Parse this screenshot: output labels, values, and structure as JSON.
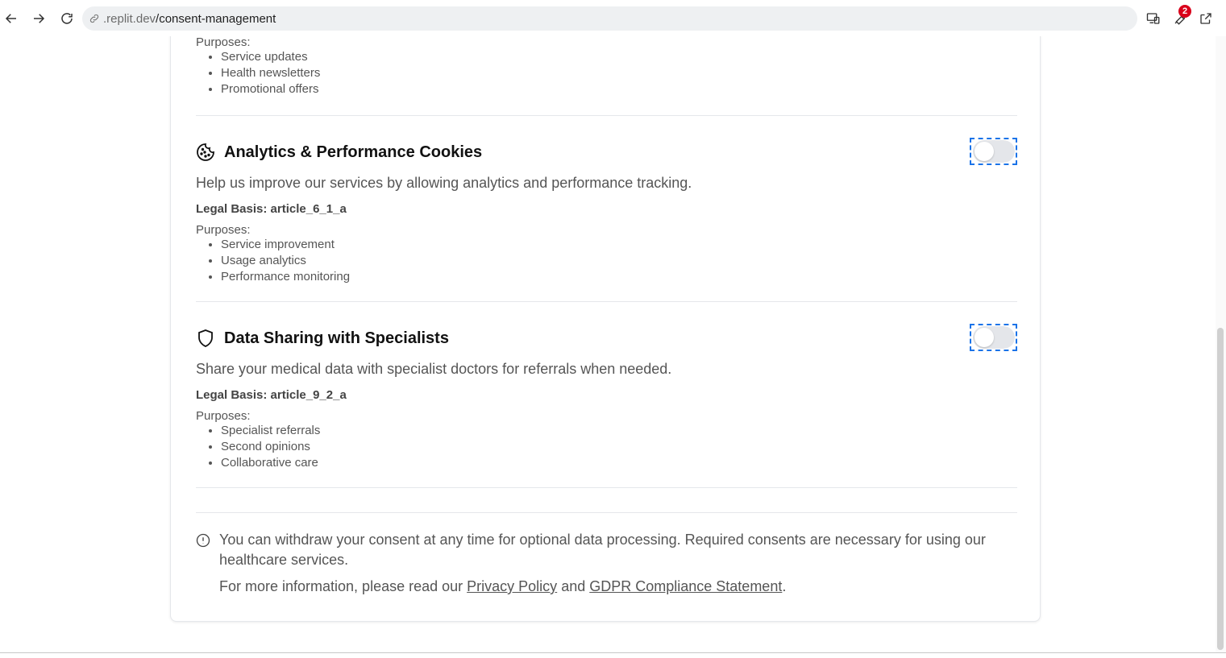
{
  "browser": {
    "url_host": ".replit.dev",
    "url_path": "/consent-management",
    "extensions_badge": "2"
  },
  "prev_section": {
    "purposes_label": "Purposes:",
    "purposes": [
      "Service updates",
      "Health newsletters",
      "Promotional offers"
    ]
  },
  "analytics": {
    "title": "Analytics & Performance Cookies",
    "icon": "cookie-icon",
    "description": "Help us improve our services by allowing analytics and performance tracking.",
    "legal_basis": "Legal Basis: article_6_1_a",
    "purposes_label": "Purposes:",
    "purposes": [
      "Service improvement",
      "Usage analytics",
      "Performance monitoring"
    ],
    "enabled": false
  },
  "sharing": {
    "title": "Data Sharing with Specialists",
    "icon": "shield-icon",
    "description": "Share your medical data with specialist doctors for referrals when needed.",
    "legal_basis": "Legal Basis: article_9_2_a",
    "purposes_label": "Purposes:",
    "purposes": [
      "Specialist referrals",
      "Second opinions",
      "Collaborative care"
    ],
    "enabled": false
  },
  "notice": {
    "withdraw_text": "You can withdraw your consent at any time for optional data processing. Required consents are necessary for using our healthcare services.",
    "more_prefix": "For more information, please read our ",
    "privacy_link": "Privacy Policy",
    "and": " and ",
    "gdpr_link": "GDPR Compliance Statement",
    "suffix": "."
  }
}
